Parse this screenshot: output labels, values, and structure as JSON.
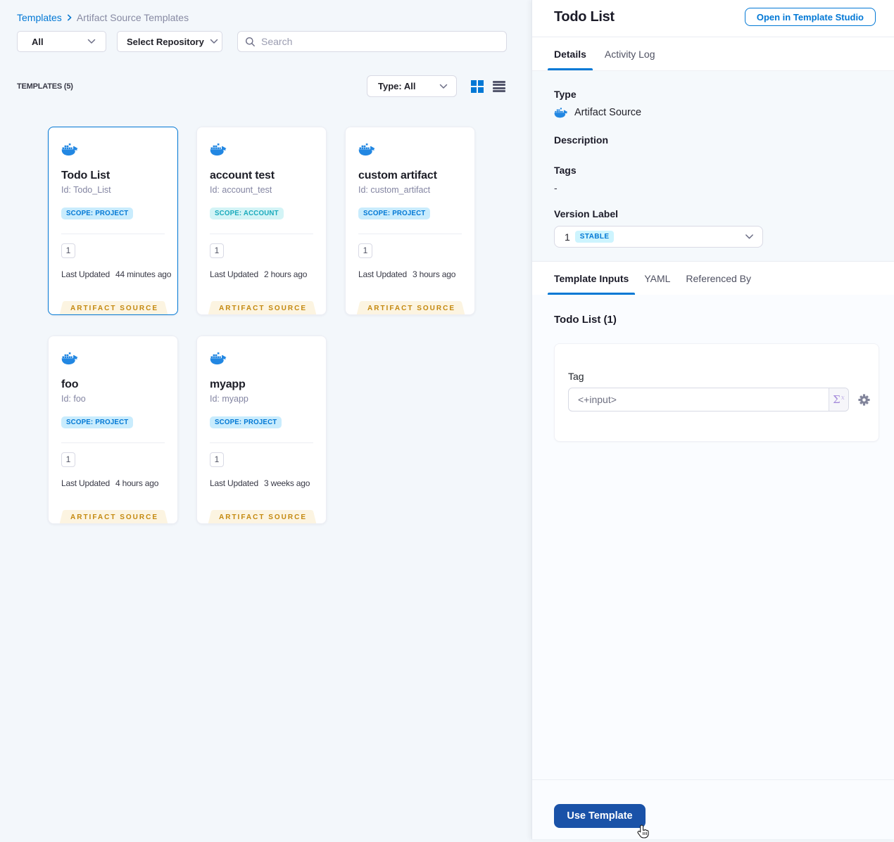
{
  "colors": {
    "accent_blue": "#0278d5",
    "docker_blue": "#2287e2",
    "ribbon_bg": "#fcf4e1",
    "ribbon_text": "#c4880e",
    "scope_project_bg": "#c9ecfd",
    "scope_account_bg": "#d3f4f6",
    "scope_account_text": "#1aaabc",
    "use_template_bg": "#1a52a8",
    "page_bg": "#f3f7fb"
  },
  "breadcrumb": {
    "root": "Templates",
    "current": "Artifact Source Templates"
  },
  "filters": {
    "scope_select": "All",
    "repo_select": "Select Repository",
    "search_placeholder": "Search"
  },
  "list_header": {
    "count": "TEMPLATES (5)",
    "type_filter": "Type: All"
  },
  "cards": [
    {
      "title": "Todo List",
      "id": "Id: Todo_List",
      "scope": "SCOPE: PROJECT",
      "version": "1",
      "updated_label": "Last Updated",
      "updated": "44 minutes ago",
      "ribbon": "ARTIFACT SOURCE"
    },
    {
      "title": "account test",
      "id": "Id: account_test",
      "scope": "SCOPE: ACCOUNT",
      "version": "1",
      "updated_label": "Last Updated",
      "updated": "2 hours ago",
      "ribbon": "ARTIFACT SOURCE"
    },
    {
      "title": "custom artifact",
      "id": "Id: custom_artifact",
      "scope": "SCOPE: PROJECT",
      "version": "1",
      "updated_label": "Last Updated",
      "updated": "3 hours ago",
      "ribbon": "ARTIFACT SOURCE"
    },
    {
      "title": "foo",
      "id": "Id: foo",
      "scope": "SCOPE: PROJECT",
      "version": "1",
      "updated_label": "Last Updated",
      "updated": "4 hours ago",
      "ribbon": "ARTIFACT SOURCE"
    },
    {
      "title": "myapp",
      "id": "Id: myapp",
      "scope": "SCOPE: PROJECT",
      "version": "1",
      "updated_label": "Last Updated",
      "updated": "3 weeks ago",
      "ribbon": "ARTIFACT SOURCE"
    }
  ],
  "panel": {
    "title": "Todo List",
    "open_button": "Open in Template Studio",
    "tabs": {
      "details": "Details",
      "activity_log": "Activity Log"
    },
    "fields": {
      "type_label": "Type",
      "type_value": "Artifact Source",
      "description_label": "Description",
      "tags_label": "Tags",
      "tags_value": "-",
      "version_label": "Version Label",
      "version_value": "1",
      "version_badge": "STABLE"
    },
    "inner_tabs": {
      "template_inputs": "Template Inputs",
      "yaml": "YAML",
      "referenced_by": "Referenced By"
    },
    "inputs": {
      "heading": "Todo List (1)",
      "tag_label": "Tag",
      "tag_value": "<+input>"
    },
    "use_button": "Use Template"
  }
}
